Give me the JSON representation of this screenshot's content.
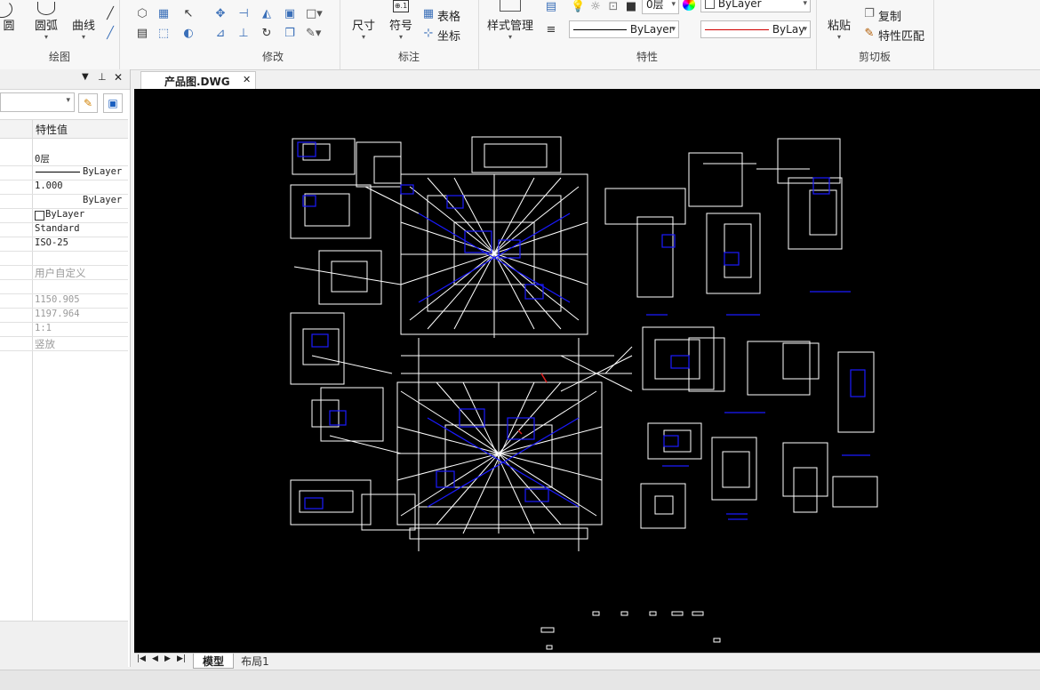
{
  "ribbon": {
    "draw_group": {
      "label": "绘图",
      "circle": "圆",
      "arc": "圆弧",
      "curve": "曲线"
    },
    "modify_group": {
      "label": "修改"
    },
    "annotate_group": {
      "label": "标注",
      "dimension": "尺寸",
      "symbol": "符号",
      "table": "表格",
      "coordinate": "坐标"
    },
    "properties_group": {
      "label": "特性",
      "style_manager": "样式管理",
      "layer_value": "0层",
      "color_value": "ByLayer",
      "linetype_value": "ByLayer",
      "lineweight_value": "ByLay"
    },
    "clipboard_group": {
      "label": "剪切板",
      "paste": "粘贴",
      "copy": "复制",
      "match_props": "特性匹配"
    }
  },
  "properties_panel": {
    "column_header": "特性值",
    "rows": [
      {
        "value": "0层"
      },
      {
        "value": "ByLayer"
      },
      {
        "value": "1.000"
      },
      {
        "value": "ByLayer"
      },
      {
        "value": "ByLayer"
      },
      {
        "value": "Standard"
      },
      {
        "value": "ISO-25"
      },
      {
        "value": ""
      },
      {
        "value": "用户自定义"
      },
      {
        "value": ""
      },
      {
        "value": "1150.905"
      },
      {
        "value": "1197.964"
      },
      {
        "value": "1:1"
      },
      {
        "value": "竖放"
      }
    ]
  },
  "document": {
    "tab_title": "产品图.DWG"
  },
  "layout_tabs": {
    "model": "模型",
    "layout1": "布局1"
  },
  "colors": {
    "canvas_bg": "#000000",
    "line_white": "#ffffff",
    "line_blue": "#1a1aff",
    "accent_red": "#e02020"
  }
}
